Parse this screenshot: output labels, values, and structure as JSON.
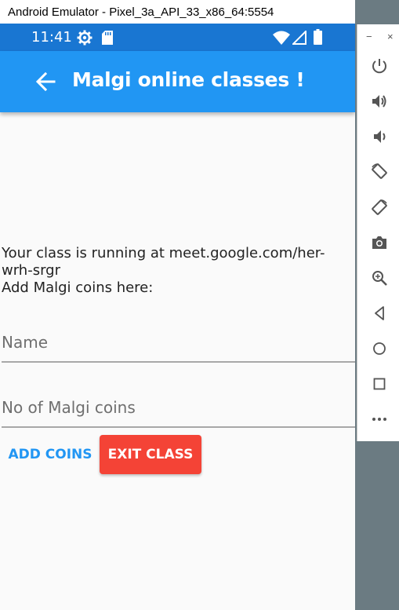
{
  "window": {
    "title": "Android Emulator - Pixel_3a_API_33_x86_64:5554"
  },
  "status_bar": {
    "time": "11:41"
  },
  "app_bar": {
    "title": "Malgi online classes !"
  },
  "main": {
    "class_text": "Your class is running at meet.google.com/her-wrh-srgr",
    "coins_prompt": "Add Malgi coins here:",
    "name_placeholder": "Name",
    "coins_placeholder": "No of Malgi coins",
    "add_coins_label": "ADD COINS",
    "exit_class_label": "EXIT CLASS"
  },
  "side_toolbar": {
    "minimize": "−",
    "close": "×",
    "items": [
      "power-icon",
      "volume-up-icon",
      "volume-down-icon",
      "rotate-left-icon",
      "rotate-right-icon",
      "camera-icon",
      "zoom-icon",
      "back-icon",
      "home-icon",
      "overview-icon",
      "more-icon"
    ]
  },
  "colors": {
    "status_bar": "#1976d2",
    "app_bar": "#2196f3",
    "add_button_text": "#2196f3",
    "exit_button": "#f44336",
    "emulator_bg": "#6b7b82"
  }
}
